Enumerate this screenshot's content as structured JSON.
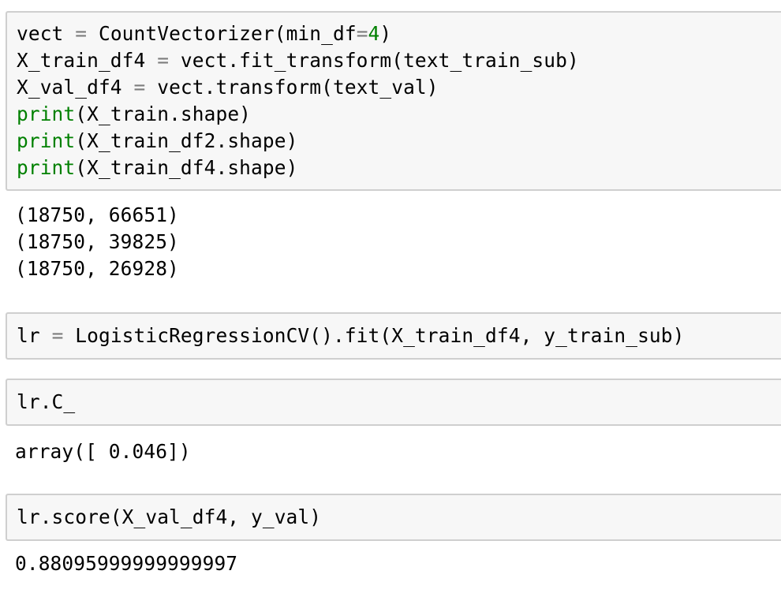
{
  "cells": [
    {
      "input_lines": [
        [
          {
            "t": "vect ",
            "c": ""
          },
          {
            "t": "=",
            "c": "op"
          },
          {
            "t": " CountVectorizer(min_df",
            "c": ""
          },
          {
            "t": "=",
            "c": "op"
          },
          {
            "t": "4",
            "c": "num"
          },
          {
            "t": ")",
            "c": ""
          }
        ],
        [
          {
            "t": "X_train_df4 ",
            "c": ""
          },
          {
            "t": "=",
            "c": "op"
          },
          {
            "t": " vect.fit_transform(text_train_sub)",
            "c": ""
          }
        ],
        [
          {
            "t": "X_val_df4 ",
            "c": ""
          },
          {
            "t": "=",
            "c": "op"
          },
          {
            "t": " vect.transform(text_val)",
            "c": ""
          }
        ],
        [
          {
            "t": "print",
            "c": "kw"
          },
          {
            "t": "(X_train.shape)",
            "c": ""
          }
        ],
        [
          {
            "t": "print",
            "c": "kw"
          },
          {
            "t": "(X_train_df2.shape)",
            "c": ""
          }
        ],
        [
          {
            "t": "print",
            "c": "kw"
          },
          {
            "t": "(X_train_df4.shape)",
            "c": ""
          }
        ]
      ],
      "output_lines": [
        "(18750, 66651)",
        "(18750, 39825)",
        "(18750, 26928)"
      ]
    },
    {
      "input_lines": [
        [
          {
            "t": "lr ",
            "c": ""
          },
          {
            "t": "=",
            "c": "op"
          },
          {
            "t": " LogisticRegressionCV().fit(X_train_df4, y_train_sub)",
            "c": ""
          }
        ]
      ],
      "output_lines": []
    },
    {
      "input_lines": [
        [
          {
            "t": "lr.C_",
            "c": ""
          }
        ]
      ],
      "output_lines": [
        "array([ 0.046])"
      ]
    },
    {
      "input_lines": [
        [
          {
            "t": "lr.score(X_val_df4, y_val)",
            "c": ""
          }
        ]
      ],
      "output_lines": [
        "0.88095999999999997"
      ]
    }
  ]
}
